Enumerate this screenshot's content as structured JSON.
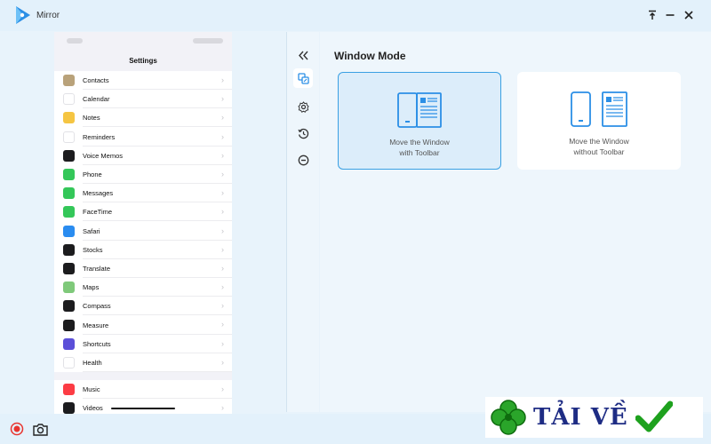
{
  "app": {
    "title": "Mirror"
  },
  "window_controls": [
    "pin-icon",
    "minimize-icon",
    "close-icon"
  ],
  "phone": {
    "title": "Settings",
    "list_primary": [
      {
        "label": "Contacts",
        "icon": "contacts-icon",
        "color": "#b9a27a"
      },
      {
        "label": "Calendar",
        "icon": "calendar-icon",
        "color": "#ffffff"
      },
      {
        "label": "Notes",
        "icon": "notes-icon",
        "color": "#f5c542"
      },
      {
        "label": "Reminders",
        "icon": "reminders-icon",
        "color": "#ffffff"
      },
      {
        "label": "Voice Memos",
        "icon": "voice-memos-icon",
        "color": "#1c1c1e"
      },
      {
        "label": "Phone",
        "icon": "phone-icon",
        "color": "#34c759"
      },
      {
        "label": "Messages",
        "icon": "messages-icon",
        "color": "#34c759"
      },
      {
        "label": "FaceTime",
        "icon": "facetime-icon",
        "color": "#34c759"
      },
      {
        "label": "Safari",
        "icon": "safari-icon",
        "color": "#2a8cf0"
      },
      {
        "label": "Stocks",
        "icon": "stocks-icon",
        "color": "#1c1c1e"
      },
      {
        "label": "Translate",
        "icon": "translate-icon",
        "color": "#1c1c1e"
      },
      {
        "label": "Maps",
        "icon": "maps-icon",
        "color": "#7fc97a"
      },
      {
        "label": "Compass",
        "icon": "compass-icon",
        "color": "#1c1c1e"
      },
      {
        "label": "Measure",
        "icon": "measure-icon",
        "color": "#1c1c1e"
      },
      {
        "label": "Shortcuts",
        "icon": "shortcuts-icon",
        "color": "#5b4fd8"
      },
      {
        "label": "Health",
        "icon": "health-icon",
        "color": "#ffffff"
      }
    ],
    "list_secondary": [
      {
        "label": "Music",
        "icon": "music-icon",
        "color": "#fc3c44"
      },
      {
        "label": "Videos",
        "icon": "tv-icon",
        "color": "#1c1c1e"
      }
    ]
  },
  "toolbar": [
    "collapse-icon",
    "window-mode-icon",
    "settings-icon",
    "history-icon",
    "more-icon"
  ],
  "main": {
    "heading": "Window Mode",
    "options": [
      {
        "line1": "Move the Window",
        "line2": "with Toolbar",
        "selected": true
      },
      {
        "line1": "Move the Window",
        "line2": "without Toolbar",
        "selected": false
      }
    ]
  },
  "footer": {
    "buttons": [
      "record-icon",
      "screenshot-icon"
    ]
  },
  "watermark": {
    "text": "TẢI VỀ"
  }
}
